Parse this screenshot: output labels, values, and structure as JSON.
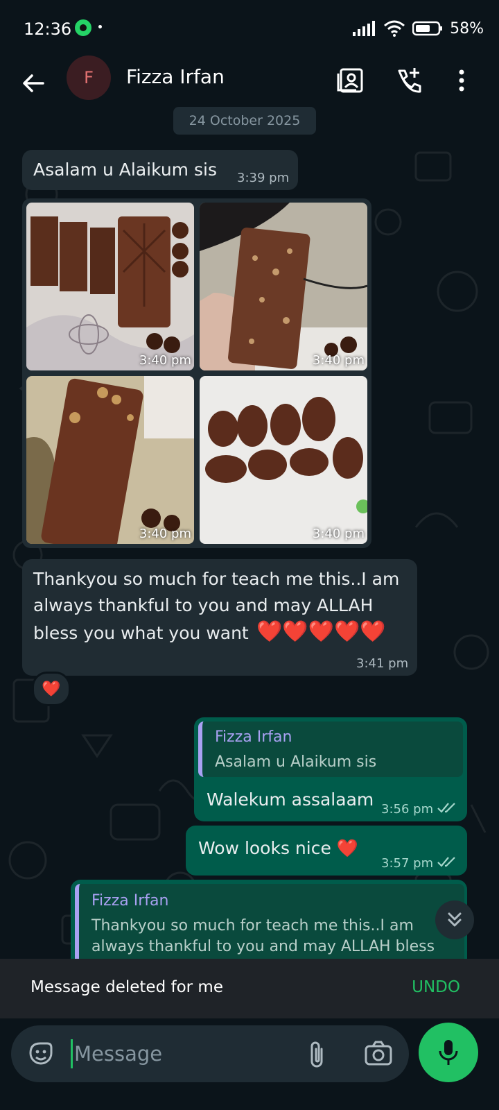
{
  "status": {
    "time": "12:36",
    "battery": "58%"
  },
  "header": {
    "avatar_letter": "F",
    "contact_name": "Fizza Irfan"
  },
  "date_chip": "24 October 2025",
  "messages": {
    "greeting": {
      "text": "Asalam u Alaikum sis",
      "time": "3:39 pm"
    },
    "photos": [
      {
        "time": "3:40 pm"
      },
      {
        "time": "3:40 pm"
      },
      {
        "time": "3:40 pm"
      },
      {
        "time": "3:40 pm"
      }
    ],
    "thanks": {
      "line1": "Thankyou so much for teach me this..I am",
      "line2": "always thankful to you and may ALLAH",
      "line3": "bless you what you want",
      "hearts": "❤️❤️❤️❤️❤️",
      "time": "3:41 pm",
      "reaction": "❤️"
    },
    "reply1": {
      "quote_name": "Fizza Irfan",
      "quote_text": "Asalam u Alaikum sis",
      "text": "Walekum assalaam",
      "time": "3:56 pm"
    },
    "wow": {
      "text": "Wow looks nice ❤️",
      "time": "3:57 pm"
    },
    "reply2": {
      "quote_name": "Fizza Irfan",
      "quote_line1": "Thankyou so much for teach me this..I am",
      "quote_line2": "always thankful to you and may ALLAH bless"
    }
  },
  "snackbar": {
    "text": "Message deleted for me",
    "action": "UNDO"
  },
  "composer": {
    "placeholder": "Message"
  },
  "colors": {
    "background": "#0b141a",
    "incoming": "#202c33",
    "outgoing": "#005c4b",
    "accent": "#21c063",
    "quote_bar": "#a9a1f2"
  },
  "icons": [
    "back-arrow-icon",
    "contact-card-icon",
    "add-call-icon",
    "more-vert-icon",
    "sticker-icon",
    "attach-icon",
    "camera-icon",
    "mic-icon",
    "double-chevron-down-icon",
    "double-check-icon"
  ]
}
